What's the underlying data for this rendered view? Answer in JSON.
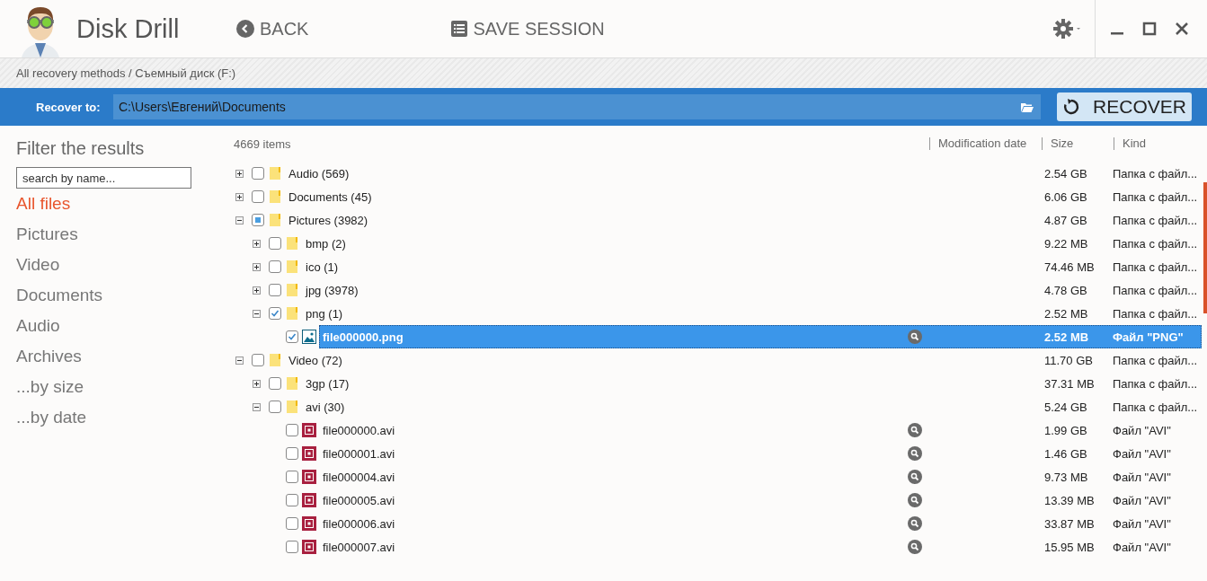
{
  "app": {
    "title": "Disk Drill",
    "back": "BACK",
    "save_session": "SAVE SESSION"
  },
  "breadcrumb": "All recovery methods / Съемный диск (F:)",
  "recover_bar": {
    "label": "Recover to:",
    "path": "C:\\Users\\Евгений\\Documents",
    "button": "RECOVER"
  },
  "sidebar": {
    "title": "Filter the results",
    "search": {
      "placeholder": "search by name..."
    },
    "items": [
      {
        "label": "All files",
        "selected": true
      },
      {
        "label": "Pictures",
        "selected": false
      },
      {
        "label": "Video",
        "selected": false
      },
      {
        "label": "Documents",
        "selected": false
      },
      {
        "label": "Audio",
        "selected": false
      },
      {
        "label": "Archives",
        "selected": false
      },
      {
        "label": "...by size",
        "selected": false
      },
      {
        "label": "...by date",
        "selected": false
      }
    ]
  },
  "table": {
    "count": "4669 items",
    "columns": [
      "Modification date",
      "Size",
      "Kind"
    ],
    "tree": [
      {
        "kind": "folder",
        "name": "Audio (569)",
        "size": "2.54 GB",
        "type": "Папка с файл...",
        "expanded": false,
        "checked": false,
        "partial": false,
        "selected": false
      },
      {
        "kind": "folder",
        "name": "Documents (45)",
        "size": "6.06 GB",
        "type": "Папка с файл...",
        "expanded": false,
        "checked": false,
        "partial": false,
        "selected": false
      },
      {
        "kind": "folder",
        "name": "Pictures (3982)",
        "size": "4.87 GB",
        "type": "Папка с файл...",
        "expanded": true,
        "checked": false,
        "partial": true,
        "selected": false,
        "children": [
          {
            "kind": "folder",
            "name": "bmp (2)",
            "size": "9.22 MB",
            "type": "Папка с файл...",
            "expanded": false,
            "checked": false,
            "partial": false,
            "selected": false
          },
          {
            "kind": "folder",
            "name": "ico (1)",
            "size": "74.46 MB",
            "type": "Папка с файл...",
            "expanded": false,
            "checked": false,
            "partial": false,
            "selected": false
          },
          {
            "kind": "folder",
            "name": "jpg (3978)",
            "size": "4.78 GB",
            "type": "Папка с файл...",
            "expanded": false,
            "checked": false,
            "partial": false,
            "selected": false
          },
          {
            "kind": "folder",
            "name": "png (1)",
            "size": "2.52 MB",
            "type": "Папка с файл...",
            "expanded": true,
            "checked": true,
            "partial": false,
            "selected": false,
            "children": [
              {
                "kind": "image",
                "name": "file000000.png",
                "size": "2.52 MB",
                "type": "Файл \"PNG\"",
                "checked": true,
                "partial": false,
                "selected": true
              }
            ]
          }
        ]
      },
      {
        "kind": "folder",
        "name": "Video (72)",
        "size": "11.70 GB",
        "type": "Папка с файл...",
        "expanded": true,
        "checked": false,
        "partial": false,
        "selected": false,
        "children": [
          {
            "kind": "folder",
            "name": "3gp (17)",
            "size": "37.31 MB",
            "type": "Папка с файл...",
            "expanded": false,
            "checked": false,
            "partial": false,
            "selected": false
          },
          {
            "kind": "folder",
            "name": "avi (30)",
            "size": "5.24 GB",
            "type": "Папка с файл...",
            "expanded": true,
            "checked": false,
            "partial": false,
            "selected": false,
            "children": [
              {
                "kind": "video",
                "name": "file000000.avi",
                "size": "1.99 GB",
                "type": "Файл \"AVI\"",
                "checked": false,
                "partial": false,
                "selected": false
              },
              {
                "kind": "video",
                "name": "file000001.avi",
                "size": "1.46 GB",
                "type": "Файл \"AVI\"",
                "checked": false,
                "partial": false,
                "selected": false
              },
              {
                "kind": "video",
                "name": "file000004.avi",
                "size": "9.73 MB",
                "type": "Файл \"AVI\"",
                "checked": false,
                "partial": false,
                "selected": false
              },
              {
                "kind": "video",
                "name": "file000005.avi",
                "size": "13.39 MB",
                "type": "Файл \"AVI\"",
                "checked": false,
                "partial": false,
                "selected": false
              },
              {
                "kind": "video",
                "name": "file000006.avi",
                "size": "33.87 MB",
                "type": "Файл \"AVI\"",
                "checked": false,
                "partial": false,
                "selected": false
              },
              {
                "kind": "video",
                "name": "file000007.avi",
                "size": "15.95 MB",
                "type": "Файл \"AVI\"",
                "checked": false,
                "partial": false,
                "selected": false
              }
            ]
          }
        ]
      }
    ]
  }
}
